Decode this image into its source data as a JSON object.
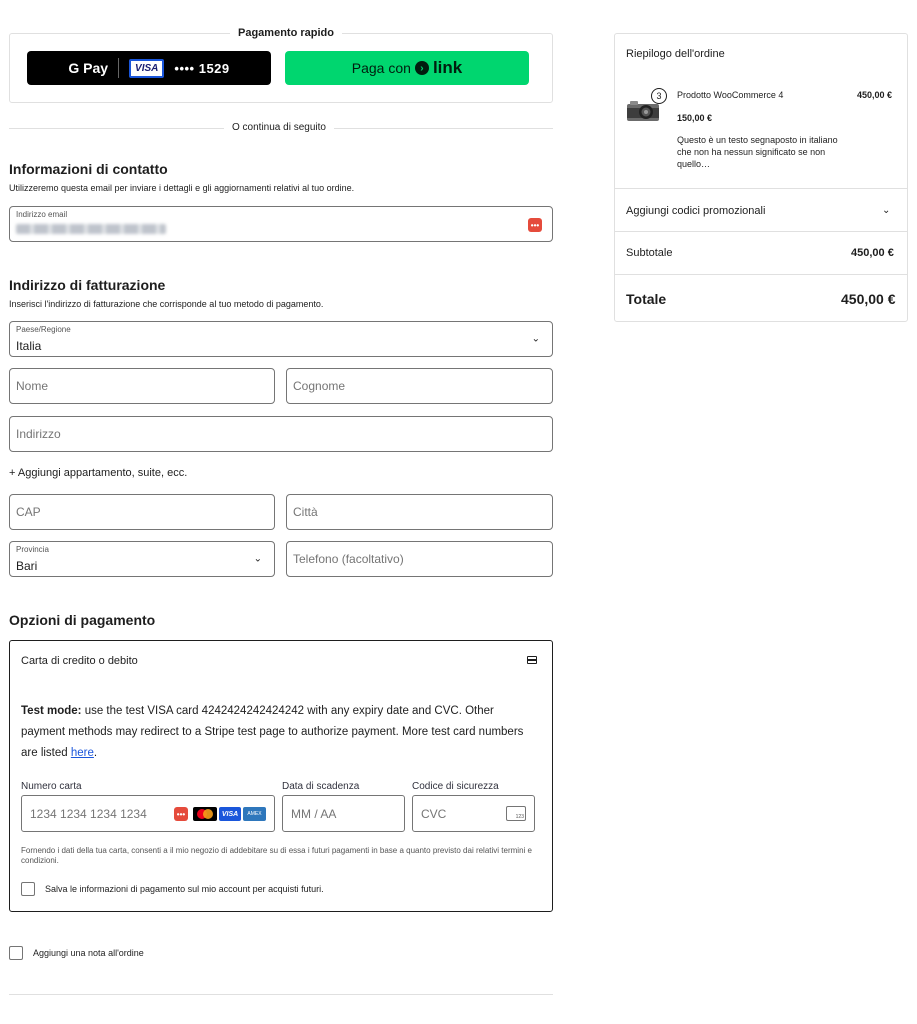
{
  "express": {
    "title": "Pagamento rapido",
    "gpay_logo": "G Pay",
    "gpay_card_brand": "VISA",
    "gpay_card_last4": "•••• 1529",
    "link_prefix": "Paga con",
    "link_brand": "link"
  },
  "divider_text": "O continua di seguito",
  "contact": {
    "heading": "Informazioni di contatto",
    "description": "Utilizzeremo questa email per inviare i dettagli e gli aggiornamenti relativi al tuo ordine.",
    "email_label": "Indirizzo email"
  },
  "billing": {
    "heading": "Indirizzo di fatturazione",
    "description": "Inserisci l'indirizzo di fatturazione che corrisponde al tuo metodo di pagamento.",
    "country_label": "Paese/Regione",
    "country_value": "Italia",
    "first_name_placeholder": "Nome",
    "last_name_placeholder": "Cognome",
    "address_placeholder": "Indirizzo",
    "add_apartment": "+ Aggiungi appartamento, suite, ecc.",
    "postcode_placeholder": "CAP",
    "city_placeholder": "Città",
    "province_label": "Provincia",
    "province_value": "Bari",
    "phone_placeholder": "Telefono (facoltativo)"
  },
  "payment": {
    "heading": "Opzioni di pagamento",
    "method_label": "Carta di credito o debito",
    "test_mode_bold": "Test mode:",
    "test_mode_text": " use the test VISA card 4242424242424242 with any expiry date and CVC. Other payment methods may redirect to a Stripe test page to authorize payment. More test card numbers are listed ",
    "test_mode_link": "here",
    "test_mode_end": ".",
    "card_number_label": "Numero carta",
    "card_number_placeholder": "1234 1234 1234 1234",
    "expiry_label": "Data di scadenza",
    "expiry_placeholder": "MM / AA",
    "cvc_label": "Codice di sicurezza",
    "cvc_placeholder": "CVC",
    "cvc_icon_text": "123",
    "consent": "Fornendo i dati della tua carta, consenti a il mio negozio di addebitare su di essa i futuri pagamenti in base a quanto previsto dai relativi termini e condizioni.",
    "save_label": "Salva le informazioni di pagamento sul mio account per acquisti futuri."
  },
  "order_note_label": "Aggiungi una nota all'ordine",
  "summary": {
    "title": "Riepilogo dell'ordine",
    "quantity": "3",
    "product_name": "Prodotto WooCommerce 4",
    "product_total": "450,00 €",
    "product_price": "150,00 €",
    "product_description": "Questo è un testo segnaposto in italiano che non ha nessun significato se non quello…",
    "promo_label": "Aggiungi codici promozionali",
    "subtotal_label": "Subtotale",
    "subtotal_value": "450,00 €",
    "total_label": "Totale",
    "total_value": "450,00 €"
  },
  "colors": {
    "link_green": "#00d66f",
    "accent_blue": "#1a56db",
    "key_red": "#e54b3c"
  }
}
